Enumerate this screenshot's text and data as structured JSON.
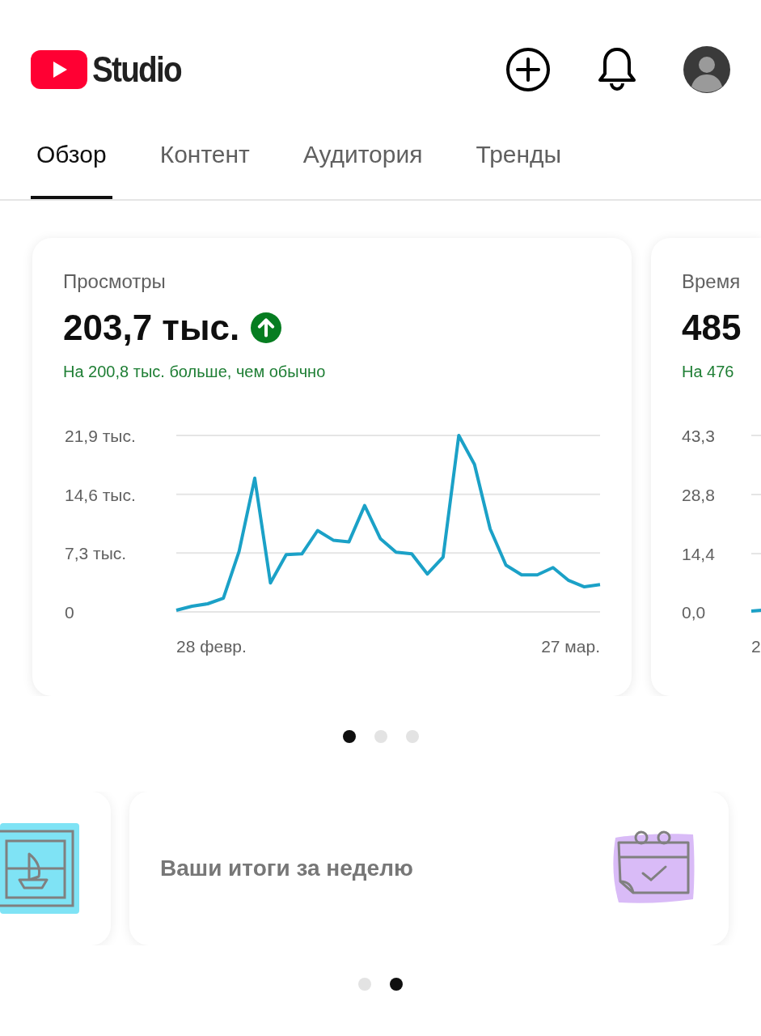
{
  "header": {
    "logo_text": "Studio"
  },
  "tabs": [
    {
      "label": "Обзор",
      "selected": true
    },
    {
      "label": "Контент",
      "selected": false
    },
    {
      "label": "Аудитория",
      "selected": false
    },
    {
      "label": "Тренды",
      "selected": false
    }
  ],
  "stat_cards": [
    {
      "title": "Просмотры",
      "value": "203,7 тыс.",
      "trend_up": true,
      "note": "На 200,8 тыс. больше, чем обычно",
      "chart_data": {
        "type": "line",
        "ylim": [
          0,
          21.9
        ],
        "yticks": [
          {
            "value": 0,
            "label": "0"
          },
          {
            "value": 7.3,
            "label": "7,3 тыс."
          },
          {
            "value": 14.6,
            "label": "14,6 тыс."
          },
          {
            "value": 21.9,
            "label": "21,9 тыс."
          }
        ],
        "series": [
          {
            "color": "#1ba1c7",
            "values": [
              0.2,
              0.7,
              1.0,
              1.7,
              7.5,
              16.6,
              3.6,
              7.1,
              7.2,
              10.1,
              8.9,
              8.7,
              13.2,
              9.1,
              7.4,
              7.2,
              4.7,
              6.8,
              21.9,
              18.3,
              10.3,
              5.8,
              4.6,
              4.6,
              5.5,
              3.9,
              3.1,
              3.4
            ]
          }
        ]
      },
      "x_labels": [
        "28 февр.",
        "27 мар."
      ]
    },
    {
      "title": "Время",
      "value": "485",
      "note": "На 476",
      "y_labels": [
        "43,3",
        "28,8",
        "14,4",
        "0,0"
      ],
      "x_label": "2"
    }
  ],
  "stat_pager": [
    {
      "selected": true
    },
    {
      "selected": false
    },
    {
      "selected": false
    }
  ],
  "summary_cards": [
    {
      "kind": "sailboat"
    },
    {
      "kind": "calendar",
      "text": "Ваши итоги за неделю"
    }
  ],
  "summary_pager": [
    {
      "selected": false
    },
    {
      "selected": true
    }
  ]
}
